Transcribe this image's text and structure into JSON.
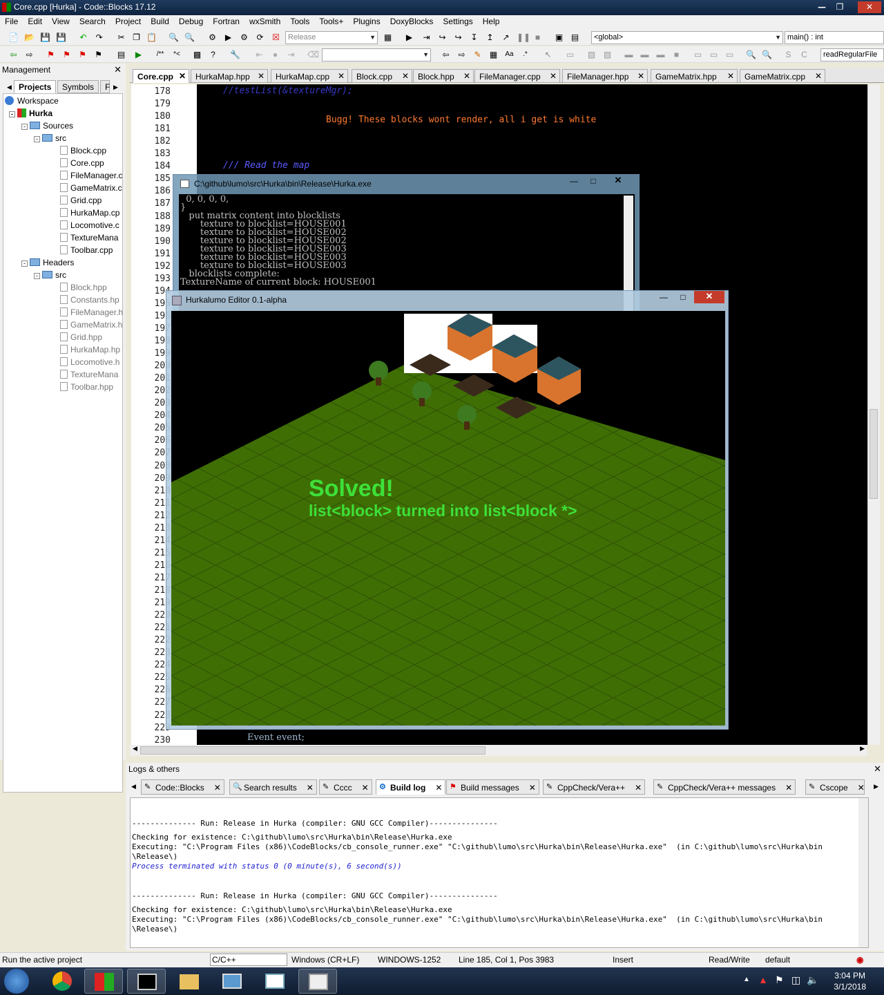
{
  "window": {
    "title": "Core.cpp [Hurka] - Code::Blocks 17.12"
  },
  "menu": [
    "File",
    "Edit",
    "View",
    "Search",
    "Project",
    "Build",
    "Debug",
    "Fortran",
    "wxSmith",
    "Tools",
    "Tools+",
    "Plugins",
    "DoxyBlocks",
    "Settings",
    "Help"
  ],
  "toolbar": {
    "build_target": "Release",
    "scope": "<global>",
    "symbol": "main() : int",
    "function": "readRegularFile"
  },
  "management": {
    "title": "Management",
    "tabs": [
      "Projects",
      "Symbols",
      "F"
    ],
    "tree": [
      {
        "label": "Workspace",
        "kind": "workspace"
      },
      {
        "label": "Hurka",
        "kind": "project"
      },
      {
        "label": "Sources",
        "kind": "folder"
      },
      {
        "label": "src",
        "kind": "folder"
      },
      {
        "label": "Block.cpp",
        "kind": "file"
      },
      {
        "label": "Core.cpp",
        "kind": "file"
      },
      {
        "label": "FileManager.c",
        "kind": "file"
      },
      {
        "label": "GameMatrix.c",
        "kind": "file"
      },
      {
        "label": "Grid.cpp",
        "kind": "file"
      },
      {
        "label": "HurkaMap.cp",
        "kind": "file"
      },
      {
        "label": "Locomotive.c",
        "kind": "file"
      },
      {
        "label": "TextureMana",
        "kind": "file"
      },
      {
        "label": "Toolbar.cpp",
        "kind": "file"
      },
      {
        "label": "Headers",
        "kind": "folder"
      },
      {
        "label": "src",
        "kind": "folder"
      },
      {
        "label": "Block.hpp",
        "kind": "hfile"
      },
      {
        "label": "Constants.hp",
        "kind": "hfile"
      },
      {
        "label": "FileManager.h",
        "kind": "hfile"
      },
      {
        "label": "GameMatrix.h",
        "kind": "hfile"
      },
      {
        "label": "Grid.hpp",
        "kind": "hfile"
      },
      {
        "label": "HurkaMap.hp",
        "kind": "hfile"
      },
      {
        "label": "Locomotive.h",
        "kind": "hfile"
      },
      {
        "label": "TextureMana",
        "kind": "hfile"
      },
      {
        "label": "Toolbar.hpp",
        "kind": "hfile"
      }
    ]
  },
  "editor": {
    "tabs": [
      "Core.cpp",
      "HurkaMap.hpp",
      "HurkaMap.cpp",
      "Block.cpp",
      "Block.hpp",
      "FileManager.cpp",
      "FileManager.hpp",
      "GameMatrix.hpp",
      "GameMatrix.cpp"
    ],
    "line_numbers": [
      "178",
      "179",
      "180",
      "181",
      "182",
      "183",
      "184",
      "185",
      "186",
      "187",
      "188",
      "189",
      "190",
      "191",
      "192",
      "193",
      "194",
      "195",
      "196",
      "197",
      "198",
      "199",
      "200",
      "201",
      "202",
      "203",
      "204",
      "205",
      "206",
      "207",
      "208",
      "209",
      "210",
      "211",
      "212",
      "213",
      "214",
      "215",
      "216",
      "217",
      "218",
      "219",
      "220",
      "221",
      "222",
      "223",
      "224",
      "225",
      "226",
      "227",
      "228",
      "229",
      "230"
    ],
    "code": {
      "line178": "//testList(&textureMgr);",
      "line180": "Bugg! These blocks wont render, all i get is white",
      "line184": "/// Read the map",
      "line230": "Event event;"
    }
  },
  "console": {
    "title": "C:\\github\\lumo\\src\\Hurka\\bin\\Release\\Hurka.exe",
    "lines": [
      "  0, 0, 0, 0,",
      "}",
      "   put matrix content into blocklists",
      "       texture to blocklist=HOUSE001",
      "       texture to blocklist=HOUSE002",
      "       texture to blocklist=HOUSE002",
      "       texture to blocklist=HOUSE003",
      "       texture to blocklist=HOUSE003",
      "       texture to blocklist=HOUSE003",
      "   blocklists complete:",
      "TextureName of current block: HOUSE001"
    ]
  },
  "game": {
    "title": "Hurkalumo Editor 0.1-alpha",
    "solved": "Solved!",
    "note": "list<block> turned into list<block *>",
    "colors": {
      "grass": "#3f6e05",
      "note": "#3ee038"
    }
  },
  "logs": {
    "title": "Logs & others",
    "tabs": [
      "Code::Blocks",
      "Search results",
      "Cccc",
      "Build log",
      "Build messages",
      "CppCheck/Vera++",
      "CppCheck/Vera++ messages",
      "Cscope"
    ],
    "lines": [
      {
        "text": "-------------- Run: Release in Hurka (compiler: GNU GCC Compiler)---------------",
        "style": "normal"
      },
      {
        "text": "",
        "style": "normal"
      },
      {
        "text": "Checking for existence: C:\\github\\lumo\\src\\Hurka\\bin\\Release\\Hurka.exe",
        "style": "normal"
      },
      {
        "text": "Executing: \"C:\\Program Files (x86)\\CodeBlocks/cb_console_runner.exe\" \"C:\\github\\lumo\\src\\Hurka\\bin\\Release\\Hurka.exe\"  (in C:\\github\\lumo\\src\\Hurka\\bin",
        "style": "normal"
      },
      {
        "text": "\\Release\\)",
        "style": "normal"
      },
      {
        "text": "Process terminated with status 0 (0 minute(s), 6 second(s))",
        "style": "status"
      },
      {
        "text": "",
        "style": "normal"
      },
      {
        "text": "",
        "style": "normal"
      },
      {
        "text": "-------------- Run: Release in Hurka (compiler: GNU GCC Compiler)---------------",
        "style": "normal"
      },
      {
        "text": "",
        "style": "normal"
      },
      {
        "text": "Checking for existence: C:\\github\\lumo\\src\\Hurka\\bin\\Release\\Hurka.exe",
        "style": "normal"
      },
      {
        "text": "Executing: \"C:\\Program Files (x86)\\CodeBlocks/cb_console_runner.exe\" \"C:\\github\\lumo\\src\\Hurka\\bin\\Release\\Hurka.exe\"  (in C:\\github\\lumo\\src\\Hurka\\bin",
        "style": "normal"
      },
      {
        "text": "\\Release\\)",
        "style": "normal"
      }
    ]
  },
  "status": {
    "message": "Run the active project",
    "language": "C/C++",
    "eol": "Windows (CR+LF)",
    "encoding": "WINDOWS-1252",
    "position": "Line 185, Col 1, Pos 3983",
    "mode": "Insert",
    "access": "Read/Write",
    "profile": "default"
  },
  "taskbar": {
    "time": "3:04 PM",
    "date": "3/1/2018"
  }
}
